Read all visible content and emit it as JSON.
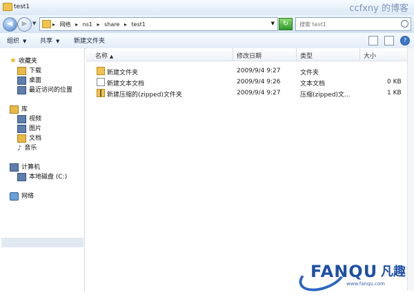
{
  "window": {
    "title": "test1",
    "watermark_top": "ccfxny 的博客"
  },
  "address": {
    "crumbs": [
      "▸",
      "网络",
      "▸",
      "ns1",
      "▸",
      "share",
      "▸",
      "test1"
    ],
    "search_placeholder": "搜索 test1"
  },
  "toolbar": {
    "organize": "组织",
    "share": "共享",
    "new_folder": "新建文件夹"
  },
  "nav": {
    "favorites": "收藏夹",
    "fav_items": [
      "下载",
      "桌面",
      "最近访问的位置"
    ],
    "libraries": "库",
    "lib_items": [
      "视频",
      "图片",
      "文档",
      "音乐"
    ],
    "computer": "计算机",
    "comp_items": [
      "本地磁盘 (C:)"
    ],
    "network": "网络"
  },
  "columns": {
    "name": "名称",
    "date": "修改日期",
    "type": "类型",
    "size": "大小"
  },
  "files": [
    {
      "name": "新建文件夹",
      "date": "2009/9/4 9:27",
      "type": "文件夹",
      "size": "",
      "icon": "folder-icon"
    },
    {
      "name": "新建文本文档",
      "date": "2009/9/4 9:26",
      "type": "文本文档",
      "size": "0 KB",
      "icon": "text-file-icon"
    },
    {
      "name": "新建压缩的(zipped)文件夹",
      "date": "2009/9/4 9:27",
      "type": "压缩(zipped)文...",
      "size": "1 KB",
      "icon": "zip-folder-icon"
    }
  ],
  "watermark": {
    "logo": "FANQU",
    "cn": "凡趣",
    "url": "www.fanqu.com"
  },
  "colors": {
    "accent": "#1d4fa5",
    "folder": "#f2c14e",
    "selection": "#e0e8f2"
  }
}
